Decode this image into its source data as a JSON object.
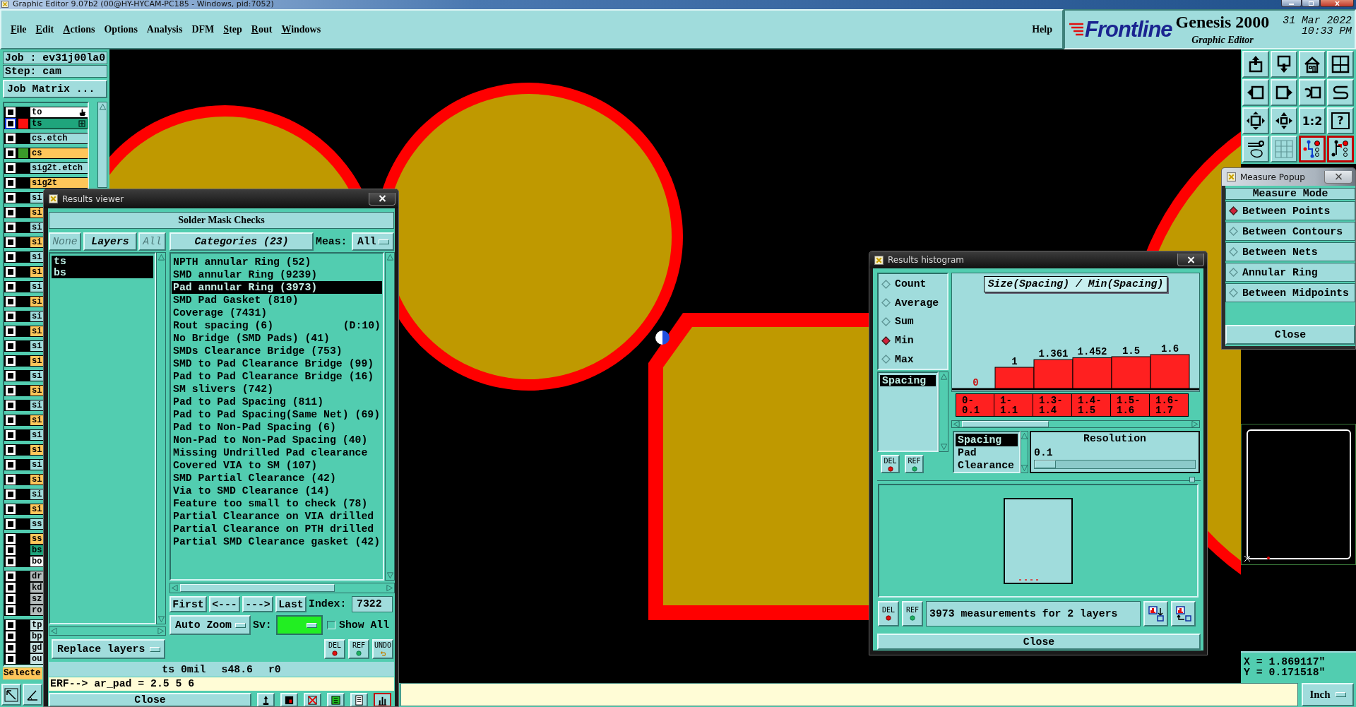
{
  "window": {
    "title": "Graphic Editor 9.07b2 (00@HY-HYCAM-PC185 - Windows, pid:7052)"
  },
  "menu": [
    {
      "label": "File",
      "mnemonic": true
    },
    {
      "label": "Edit",
      "mnemonic": true
    },
    {
      "label": "Actions",
      "mnemonic": true
    },
    {
      "label": "Options",
      "mnemonic": false
    },
    {
      "label": "Analysis",
      "mnemonic": false
    },
    {
      "label": "DFM",
      "mnemonic": false
    },
    {
      "label": "Step",
      "mnemonic": true
    },
    {
      "label": "Rout",
      "mnemonic": true
    },
    {
      "label": "Windows",
      "mnemonic": true
    }
  ],
  "help_menu": {
    "label": "Help",
    "mnemonic": false
  },
  "brand": {
    "logo": "Frontline",
    "product": "Genesis 2000",
    "subtitle": "Graphic Editor",
    "date": "31 Mar 2022",
    "time": "10:33 PM"
  },
  "job_panel": {
    "job": "Job : ev31j00la0",
    "step": "Step: cam",
    "matrix_button": "Job Matrix ...",
    "layer_groups": [
      {
        "kind": "tight",
        "layers": [
          {
            "name": "to",
            "color": "#ffffff",
            "selected": false,
            "work": true,
            "affected": false
          },
          {
            "name": "ts",
            "color": "#1fa57c",
            "display": {
              "color": "#ff1010"
            },
            "selected": true,
            "work": false,
            "affected": true
          }
        ]
      },
      {
        "kind": "spaced",
        "layers": [
          {
            "name": "cs.etch",
            "color": "#a0dcdc",
            "selected": false,
            "work": false,
            "affected": false
          },
          {
            "name": "cs",
            "color": "#ffc65a",
            "display": {
              "color": "#3a9a2a"
            },
            "selected": false,
            "work": false,
            "affected": false
          },
          {
            "name": "sig2t.etch",
            "color": "#a0dcdc",
            "selected": false,
            "work": false,
            "affected": false
          },
          {
            "name": "sig2t",
            "color": "#ffc65a",
            "selected": false,
            "work": false,
            "affected": false
          },
          {
            "name": "si",
            "color": "#a0dcdc",
            "selected": false,
            "work": false,
            "affected": false
          },
          {
            "name": "si",
            "color": "#ffc65a",
            "selected": false,
            "work": false,
            "affected": false
          },
          {
            "name": "si",
            "color": "#a0dcdc",
            "selected": false,
            "work": false,
            "affected": false
          },
          {
            "name": "si",
            "color": "#ffc65a",
            "selected": false,
            "work": false,
            "affected": false
          },
          {
            "name": "si",
            "color": "#a0dcdc",
            "selected": false,
            "work": false,
            "affected": false
          },
          {
            "name": "si",
            "color": "#ffc65a",
            "selected": false,
            "work": false,
            "affected": false
          },
          {
            "name": "si",
            "color": "#a0dcdc",
            "selected": false,
            "work": false,
            "affected": false
          },
          {
            "name": "si",
            "color": "#ffc65a",
            "selected": false,
            "work": false,
            "affected": false
          },
          {
            "name": "si",
            "color": "#a0dcdc",
            "selected": false,
            "work": false,
            "affected": false
          },
          {
            "name": "si",
            "color": "#ffc65a",
            "selected": false,
            "work": false,
            "affected": false
          },
          {
            "name": "si",
            "color": "#a0dcdc",
            "selected": false,
            "work": false,
            "affected": false
          },
          {
            "name": "si",
            "color": "#ffc65a",
            "selected": false,
            "work": false,
            "affected": false
          },
          {
            "name": "si",
            "color": "#a0dcdc",
            "selected": false,
            "work": false,
            "affected": false
          },
          {
            "name": "si",
            "color": "#ffc65a",
            "selected": false,
            "work": false,
            "affected": false
          },
          {
            "name": "si",
            "color": "#a0dcdc",
            "selected": false,
            "work": false,
            "affected": false
          },
          {
            "name": "si",
            "color": "#ffc65a",
            "selected": false,
            "work": false,
            "affected": false
          },
          {
            "name": "si",
            "color": "#a0dcdc",
            "selected": false,
            "work": false,
            "affected": false
          },
          {
            "name": "si",
            "color": "#ffc65a",
            "selected": false,
            "work": false,
            "affected": false
          },
          {
            "name": "si",
            "color": "#a0dcdc",
            "selected": false,
            "work": false,
            "affected": false
          },
          {
            "name": "si",
            "color": "#ffc65a",
            "selected": false,
            "work": false,
            "affected": false
          },
          {
            "name": "si",
            "color": "#a0dcdc",
            "selected": false,
            "work": false,
            "affected": false
          },
          {
            "name": "si",
            "color": "#ffc65a",
            "selected": false,
            "work": false,
            "affected": false
          },
          {
            "name": "ss",
            "color": "#a0dcdc",
            "selected": false,
            "work": false,
            "affected": false
          }
        ]
      },
      {
        "kind": "tight",
        "layers": [
          {
            "name": "ss",
            "color": "#ffc65a",
            "selected": false,
            "work": false,
            "affected": false
          },
          {
            "name": "bs",
            "color": "#1fa57c",
            "selected": false,
            "work": false,
            "affected": false
          },
          {
            "name": "bo",
            "color": "#ffffff",
            "selected": false,
            "work": false,
            "affected": false
          }
        ]
      },
      {
        "kind": "tight",
        "layers": [
          {
            "name": "dr",
            "color": "#b4bcbc",
            "selected": false,
            "work": false,
            "affected": false
          },
          {
            "name": "kd",
            "color": "#b4bcbc",
            "selected": false,
            "work": false,
            "affected": false
          },
          {
            "name": "sz",
            "color": "#b4bcbc",
            "selected": false,
            "work": false,
            "affected": false
          },
          {
            "name": "ro",
            "color": "#b4bcbc",
            "selected": false,
            "work": false,
            "affected": false
          }
        ]
      },
      {
        "kind": "tight",
        "layers": [
          {
            "name": "tp",
            "color": "#c8e4e4",
            "selected": false,
            "work": false,
            "affected": false
          },
          {
            "name": "bp",
            "color": "#c8e4e4",
            "selected": false,
            "work": false,
            "affected": false
          },
          {
            "name": "gd",
            "color": "#c8e4e4",
            "selected": false,
            "work": false,
            "affected": false
          },
          {
            "name": "ou",
            "color": "#c8e4e4",
            "selected": false,
            "work": false,
            "affected": false
          }
        ]
      }
    ],
    "selected_label": "Selecte"
  },
  "toolbox": [
    {
      "kind": "export",
      "on": false
    },
    {
      "kind": "import",
      "on": false
    },
    {
      "kind": "home",
      "on": false
    },
    {
      "kind": "panes",
      "on": false
    },
    {
      "kind": "prev",
      "on": false
    },
    {
      "kind": "next",
      "on": false
    },
    {
      "kind": "undo",
      "on": false
    },
    {
      "kind": "curve",
      "on": false
    },
    {
      "kind": "fit",
      "on": false
    },
    {
      "kind": "center",
      "on": false
    },
    {
      "kind": "text",
      "label": "1:2",
      "on": false
    },
    {
      "kind": "framed",
      "label": "?",
      "on": false
    },
    {
      "kind": "tools",
      "on": false
    },
    {
      "kind": "grid",
      "on": false
    },
    {
      "kind": "nets",
      "on": true
    },
    {
      "kind": "nets2",
      "on": true
    }
  ],
  "measure_popup": {
    "title": "Measure Popup",
    "heading": "Measure Mode",
    "modes": [
      {
        "label": "Between Points",
        "selected": true
      },
      {
        "label": "Between Contours",
        "selected": false
      },
      {
        "label": "Between Nets",
        "selected": false
      },
      {
        "label": "Annular Ring",
        "selected": false
      },
      {
        "label": "Between Midpoints",
        "selected": false
      }
    ],
    "close": "Close"
  },
  "coordinates": [
    "X = 1.869117\"",
    "Y = 0.171518\""
  ],
  "units": "Inch",
  "results_viewer": {
    "title": "Results viewer",
    "heading": "Solder Mask Checks",
    "layer_buttons": [
      {
        "label": "None",
        "disabled": true
      },
      {
        "label": "Layers",
        "disabled": false
      },
      {
        "label": "All",
        "disabled": true
      }
    ],
    "categories_button": "Categories (23)",
    "meas_label": "Meas:",
    "meas_value": "All",
    "layers": [
      {
        "label": "ts",
        "selected": true
      },
      {
        "label": "bs",
        "selected": true
      }
    ],
    "categories": [
      {
        "label": "NPTH annular Ring (52)",
        "selected": false
      },
      {
        "label": "SMD annular Ring (9239)",
        "selected": false
      },
      {
        "label": "Pad annular Ring (3973)",
        "selected": true
      },
      {
        "label": "SMD Pad Gasket (810)",
        "selected": false
      },
      {
        "label": "Coverage (7431)",
        "selected": false
      },
      {
        "label": "Rout spacing (6)",
        "note": "(D:10)",
        "selected": false
      },
      {
        "label": "No Bridge (SMD Pads) (41)",
        "selected": false
      },
      {
        "label": "SMDs Clearance Bridge (753)",
        "selected": false
      },
      {
        "label": "SMD to Pad Clearance Bridge (99)",
        "selected": false
      },
      {
        "label": "Pad to Pad Clearance Bridge (16)",
        "selected": false
      },
      {
        "label": "SM slivers (742)",
        "selected": false
      },
      {
        "label": "Pad to Pad Spacing (811)",
        "selected": false
      },
      {
        "label": "Pad to Pad Spacing(Same Net) (69)",
        "selected": false
      },
      {
        "label": "Pad to Non-Pad Spacing (6)",
        "selected": false
      },
      {
        "label": "Non-Pad to Non-Pad Spacing (40)",
        "selected": false
      },
      {
        "label": "Missing Undrilled Pad clearance",
        "selected": false
      },
      {
        "label": "Covered VIA to SM (107)",
        "selected": false
      },
      {
        "label": "SMD Partial Clearance (42)",
        "selected": false
      },
      {
        "label": "Via to SMD Clearance (14)",
        "selected": false
      },
      {
        "label": "Feature too small to check (78)",
        "selected": false
      },
      {
        "label": "Partial Clearance on VIA drilled",
        "selected": false
      },
      {
        "label": "Partial Clearance on PTH drilled",
        "selected": false
      },
      {
        "label": "Partial SMD Clearance gasket (42)",
        "selected": false
      }
    ],
    "nav": [
      "First",
      "<---",
      "--->",
      "Last"
    ],
    "index_label": "Index:",
    "index_value": "7322",
    "zoom_mode": "Auto Zoom",
    "sv": {
      "label": "Sv:",
      "color": "#22ee22"
    },
    "show_all": {
      "label": "Show All",
      "checked": false
    },
    "replace_mode": "Replace layers",
    "edit_buttons": [
      {
        "kind": "del",
        "label": "DEL"
      },
      {
        "kind": "ref",
        "label": "REF"
      },
      {
        "kind": "undo",
        "label": "UNDO"
      }
    ],
    "status": [
      "ts 0mil",
      "s48.6",
      "r0"
    ],
    "erf": "ERF--> ar_pad = 2.5 5 6",
    "close": "Close",
    "tools": [
      {
        "kind": "pin",
        "on": false
      },
      {
        "kind": "stop",
        "on": false
      },
      {
        "kind": "cross",
        "on": false
      },
      {
        "kind": "count",
        "on": false
      },
      {
        "kind": "sheet",
        "on": false
      },
      {
        "kind": "chart",
        "on": true
      }
    ]
  },
  "histogram": {
    "title": "Results histogram",
    "functions": [
      {
        "label": "Count",
        "selected": false
      },
      {
        "label": "Average",
        "selected": false
      },
      {
        "label": "Sum",
        "selected": false
      },
      {
        "label": "Min",
        "selected": true
      },
      {
        "label": "Max",
        "selected": false
      }
    ],
    "measures": [
      {
        "label": "Spacing",
        "selected": true
      }
    ],
    "side_buttons": [
      {
        "kind": "del",
        "label": "DEL"
      },
      {
        "kind": "ref",
        "label": "REF"
      }
    ],
    "chart_data": {
      "type": "bar",
      "title": "Size(Spacing) / Min(Spacing)",
      "categories": [
        "0- 0.1",
        "1- 1.1",
        "1.3- 1.4",
        "1.4- 1.5",
        "1.5- 1.6",
        "1.6- 1.7"
      ],
      "values": [
        0,
        1,
        1.361,
        1.452,
        1.5,
        1.6
      ],
      "data_labels": true
    },
    "fields": [
      {
        "label": "Spacing",
        "selected": true
      },
      {
        "label": "Pad",
        "selected": false
      },
      {
        "label": "Clearance",
        "selected": false
      }
    ],
    "resolution": {
      "label": "Resolution",
      "value": "0.1",
      "level": 0
    },
    "bottom_buttons": [
      {
        "kind": "del",
        "label": "DEL"
      },
      {
        "kind": "ref",
        "label": "REF"
      }
    ],
    "summary": "3973 measurements for 2 layers",
    "close": "Close"
  }
}
